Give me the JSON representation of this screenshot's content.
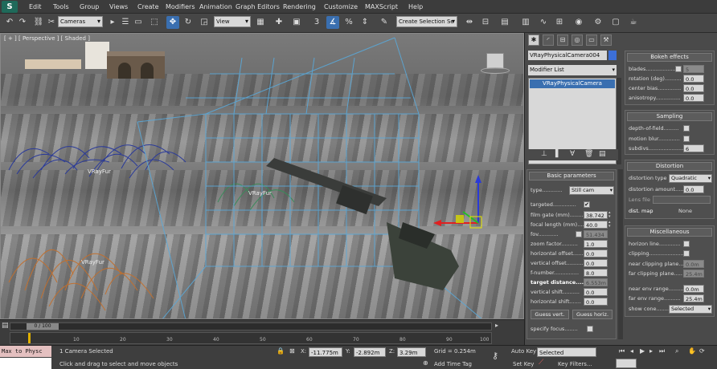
{
  "menu": {
    "logo": "S",
    "items": [
      "Edit",
      "Tools",
      "Group",
      "Views",
      "Create",
      "Modifiers",
      "Animation",
      "Graph Editors",
      "Rendering",
      "Customize",
      "MAXScript",
      "Help"
    ],
    "search_placeholder": "Create Selection Se"
  },
  "toolbar": {
    "filter_select": "Cameras",
    "ref_coord_select": "View",
    "snap_label": "3",
    "angle_snap_label": "%",
    "named_selection": "Create Selection Se"
  },
  "viewport": {
    "label": "[ + ] [ Perspective ] [ Shaded ]",
    "objects": [
      "VRayFur",
      "VRayFur",
      "VRayFur"
    ]
  },
  "timeline": {
    "frame_indicator": "0 / 100",
    "ticks": [
      "10",
      "20",
      "30",
      "40",
      "50",
      "60",
      "70",
      "80",
      "90",
      "100"
    ]
  },
  "status": {
    "maxscript_text": "Max to Physc",
    "selection_status": "1 Camera Selected",
    "prompt": "Click and drag to select and move objects",
    "x_label": "X:",
    "x_value": "-11.775m",
    "y_label": "Y:",
    "y_value": "-2.892m",
    "z_label": "Z:",
    "z_value": "3.29m",
    "grid": "Grid = 0.254m",
    "add_time_tag": "Add Time Tag",
    "auto_key": "Auto Key",
    "set_key": "Set Key",
    "key_mode": "Selected",
    "key_filters": "Key Filters..."
  },
  "command_panel": {
    "object_name": "VRayPhysicalCamera004",
    "object_color": "#3c6fd8",
    "modifier_list": "Modifier List",
    "stack_item": "VRayPhysicalCamera",
    "basic": {
      "title": "Basic parameters",
      "type_label": "type............",
      "type_value": "Still cam",
      "targeted_label": "targeted..............",
      "targeted_check": "✔",
      "film_gate_label": "film gate (mm)..........",
      "film_gate_value": "38.742",
      "focal_length_label": "focal length (mm).......",
      "focal_length_value": "40.0",
      "fov_label": "fov............",
      "fov_value": "51.434",
      "zoom_label": "zoom factor..........",
      "zoom_value": "1.0",
      "hoffset_label": "horizontal offset........",
      "hoffset_value": "0.0",
      "voffset_label": "vertical offset..........",
      "voffset_value": "0.0",
      "fnumber_label": "f-number...............",
      "fnumber_value": "8.0",
      "target_distance_label": "target distance........",
      "target_distance_value": "6.553m",
      "vshift_label": "vertical shift..........",
      "vshift_value": "0.0",
      "hshift_label": "horizontal shift.......",
      "hshift_value": "0.0",
      "guess_vert": "Guess vert.",
      "guess_horiz": "Guess horiz.",
      "specify_focus_label": "specify focus........"
    },
    "bokeh": {
      "title": "Bokeh effects",
      "blades_label": "blades..................",
      "blades_value": "5",
      "rotation_label": "rotation (deg)..........",
      "rotation_value": "0.0",
      "center_bias_label": "center bias..............",
      "center_bias_value": "0.0",
      "anisotropy_label": "anisotropy...............",
      "anisotropy_value": "0.0"
    },
    "sampling": {
      "title": "Sampling",
      "dof_label": "depth-of-field.........",
      "motion_blur_label": "motion blur.............",
      "subdivs_label": "subdivs......................",
      "subdivs_value": "6"
    },
    "distortion": {
      "title": "Distortion",
      "type_label": "distortion type",
      "type_value": "Quadratic",
      "amount_label": "distortion amount......",
      "amount_value": "0.0",
      "lens_file_label": "Lens file",
      "dist_map_label": "dist. map",
      "dist_map_value": "None"
    },
    "misc": {
      "title": "Miscellaneous",
      "horizon_label": "horizon line.............",
      "clipping_label": "clipping......................",
      "near_clip_label": "near clipping plane.....",
      "near_clip_value": "0.0m",
      "far_clip_label": "far clipping plane.....",
      "far_clip_value": "25.4m",
      "near_env_label": "near env range.........",
      "near_env_value": "0.0m",
      "far_env_label": "far env range..........",
      "far_env_value": "25.4m",
      "show_cone_label": "show cone........",
      "show_cone_value": "Selected"
    }
  }
}
